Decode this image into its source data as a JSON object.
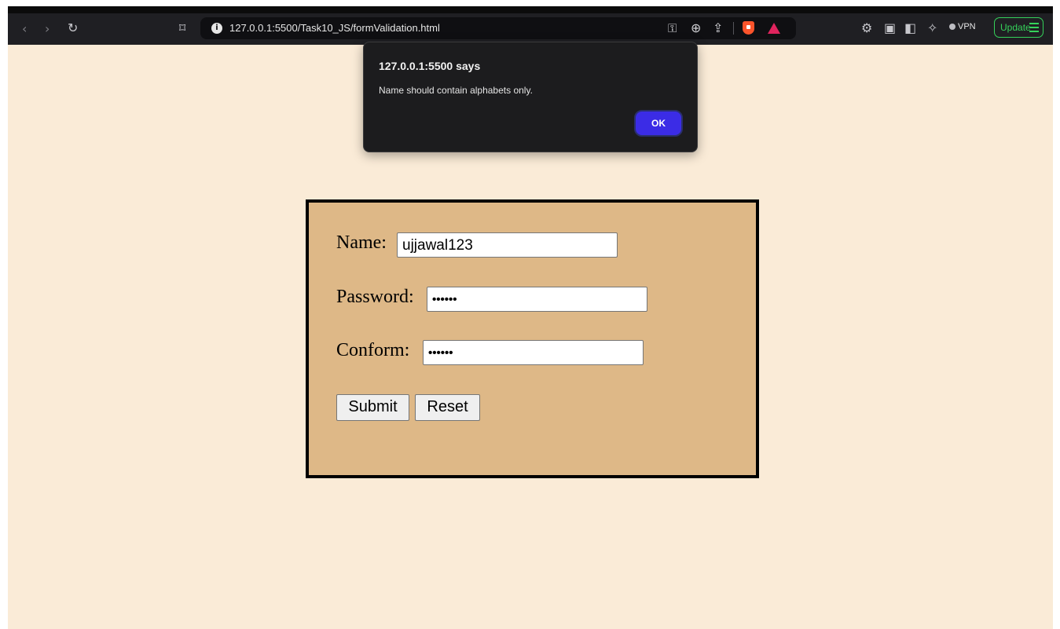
{
  "browser": {
    "url": "127.0.0.1:5500/Task10_JS/formValidation.html",
    "vpn_label": "VPN",
    "update_label": "Update",
    "accent_color": "#35d15a"
  },
  "icons": {
    "back": "‹",
    "forward": "›",
    "reload": "↻",
    "bookmark": "⌑",
    "info": "i",
    "key": "⚿",
    "zoom": "⊕",
    "share": "⇪",
    "extensions": "⚙",
    "sidebar": "▣",
    "wallet": "◧",
    "leo": "✧"
  },
  "form": {
    "name_label": "Name:",
    "name_value": "ujjawal123",
    "password_label": "Password:",
    "password_value": "••••••",
    "confirm_label": "Conform:",
    "confirm_value": "••••••",
    "submit_label": "Submit",
    "reset_label": "Reset",
    "page_bg": "#faebd7",
    "box_bg": "#deb887"
  },
  "dialog": {
    "title": "127.0.0.1:5500 says",
    "message": "Name should contain alphabets only.",
    "ok_label": "OK",
    "ok_color": "#3b2ce6"
  }
}
